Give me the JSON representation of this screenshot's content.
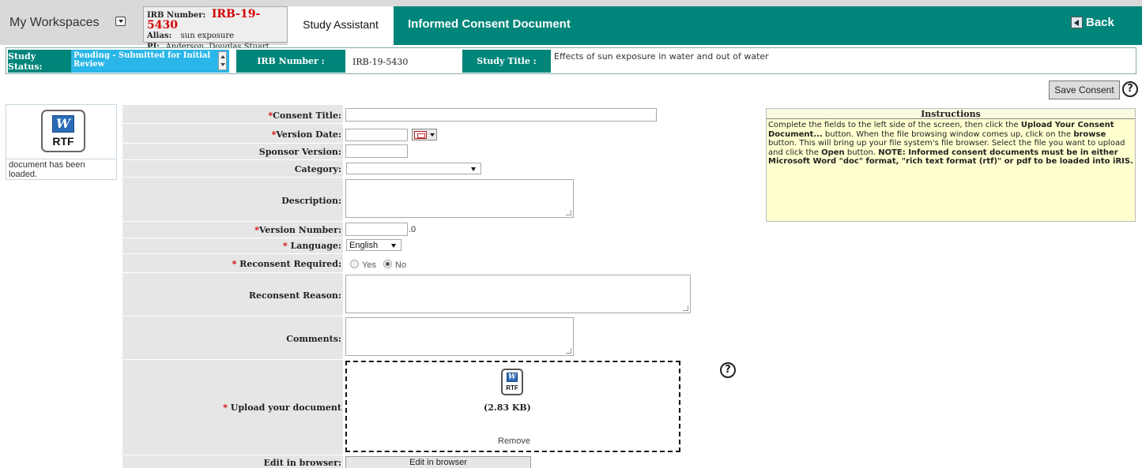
{
  "header": {
    "workspaces_label": "My Workspaces",
    "irb_number_key": "IRB Number:",
    "irb_number_value": "IRB-19-5430",
    "alias_key": "Alias:",
    "alias_value": "sun exposure",
    "pi_key": "PI:",
    "pi_value": "Anderson, Douglas Stuart, Dr.",
    "tab_assistant": "Study Assistant",
    "page_title": "Informed Consent Document",
    "back_label": "Back"
  },
  "status": {
    "status_label": "Study Status:",
    "status_value": "Pending - Submitted for Initial Review",
    "irb_label": "IRB Number :",
    "irb_value": "IRB-19-5430",
    "title_label": "Study Title :",
    "title_value": "Effects of sun exposure in water and out of water"
  },
  "toolbar": {
    "save_label": "Save Consent",
    "help_glyph": "?"
  },
  "doc_panel": {
    "icon_letter": "W",
    "icon_text": "RTF",
    "message": "document has been loaded."
  },
  "form": {
    "consent_title": {
      "required": "*",
      "label": "Consent Title:",
      "value": ""
    },
    "version_date": {
      "required": "*",
      "label": "Version Date:",
      "value": ""
    },
    "sponsor_version": {
      "label": "Sponsor Version:",
      "value": ""
    },
    "category": {
      "label": "Category:",
      "value": ""
    },
    "description": {
      "label": "Description:",
      "value": ""
    },
    "version_number": {
      "required": "*",
      "label": "Version Number:",
      "value": "",
      "suffix": ".0"
    },
    "language": {
      "required": "*",
      "label": " Language:",
      "value": "English"
    },
    "reconsent_required": {
      "required": "*",
      "label": " Reconsent Required:",
      "options": [
        "Yes",
        "No"
      ],
      "selected": "No"
    },
    "reconsent_reason": {
      "label": "Reconsent Reason:",
      "value": ""
    },
    "comments": {
      "label": "Comments:",
      "value": ""
    },
    "upload": {
      "required": "*",
      "label": " Upload your document",
      "icon_letter": "W",
      "icon_text": "RTF",
      "file_size": "(2.83 KB)",
      "remove_label": "Remove",
      "help_glyph": "?"
    },
    "edit_in_browser": {
      "label": "Edit in browser:",
      "button_label": "Edit in browser"
    }
  },
  "instructions": {
    "heading": "Instructions",
    "p1": "Complete the fields to the left side of the screen, then click the ",
    "b1": "Upload Your Consent Document...",
    "p2": " button. When the file browsing window comes up, click on the ",
    "b2": "browse",
    "p3": " button. This will bring up your file system's file browser. Select the file you want to upload and click the ",
    "b3": "Open",
    "p4": " button. ",
    "b4": "NOTE: Informed consent documents must be in either Microsoft Word \"doc\" format, \"rich text format (rtf)\" or pdf to be loaded into iRIS."
  }
}
